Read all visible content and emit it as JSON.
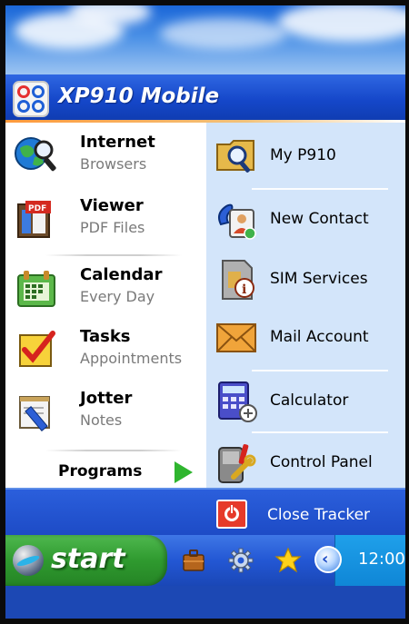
{
  "app": {
    "title": "XP910 Mobile"
  },
  "left_items": [
    {
      "title": "Internet",
      "subtitle": "Browsers",
      "icon": "globe-search-icon"
    },
    {
      "title": "Viewer",
      "subtitle": "PDF Files",
      "icon": "pdf-viewer-icon"
    },
    {
      "title": "Calendar",
      "subtitle": "Every Day",
      "icon": "calendar-icon"
    },
    {
      "title": "Tasks",
      "subtitle": "Appointments",
      "icon": "checkbox-icon"
    },
    {
      "title": "Jotter",
      "subtitle": "Notes",
      "icon": "notepad-pen-icon"
    }
  ],
  "programs": {
    "label": "Programs",
    "icon": "green-arrow-icon"
  },
  "right_items": [
    {
      "label": "My P910",
      "icon": "folder-search-icon"
    },
    {
      "label": "New Contact",
      "icon": "contact-card-icon"
    },
    {
      "label": "SIM Services",
      "icon": "sim-info-icon"
    },
    {
      "label": "Mail Account",
      "icon": "envelope-icon"
    },
    {
      "label": "Calculator",
      "icon": "calculator-icon"
    },
    {
      "label": "Control Panel",
      "icon": "control-panel-icon"
    }
  ],
  "close_tracker": {
    "label": "Close Tracker",
    "icon": "power-icon"
  },
  "taskbar": {
    "start_label": "start",
    "tray_icons": [
      "briefcase-icon",
      "gear-icon",
      "star-icon"
    ],
    "clock": "12:00"
  },
  "colors": {
    "title_bar": "#1547c9",
    "menu_left_bg": "#ffffff",
    "menu_right_bg": "#d3e5fa",
    "start_green": "#2f9a2f",
    "close_red": "#e63a2a",
    "clock_blue": "#0f86d6"
  }
}
